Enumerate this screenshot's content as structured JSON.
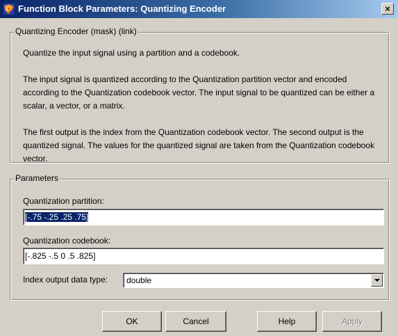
{
  "window": {
    "title": "Function Block Parameters: Quantizing Encoder",
    "close_label": "×"
  },
  "description": {
    "legend": "Quantizing Encoder (mask) (link)",
    "paragraphs": [
      "Quantize the input signal using a partition and a codebook.",
      "The input signal is quantized according to the Quantization partition vector and encoded according to the Quantization codebook vector.  The input signal to be quantized can be either a scalar, a vector, or a matrix.",
      "The first output is the index from the Quantization codebook vector. The second output is the quantized signal.  The values for the quantized signal are taken from the Quantization codebook vector."
    ]
  },
  "parameters": {
    "legend": "Parameters",
    "partition": {
      "label": "Quantization partition:",
      "value": "[-.75 -.25 .25 .75]"
    },
    "codebook": {
      "label": "Quantization codebook:",
      "value": "[-.825 -.5 0 .5 .825]"
    },
    "index_type": {
      "label": "Index output data type:",
      "value": "double"
    }
  },
  "buttons": {
    "ok": "OK",
    "cancel": "Cancel",
    "help": "Help",
    "apply": "Apply"
  },
  "icons": {
    "app": "simulink-block-icon",
    "close": "close-icon",
    "dropdown": "chevron-down-icon"
  }
}
